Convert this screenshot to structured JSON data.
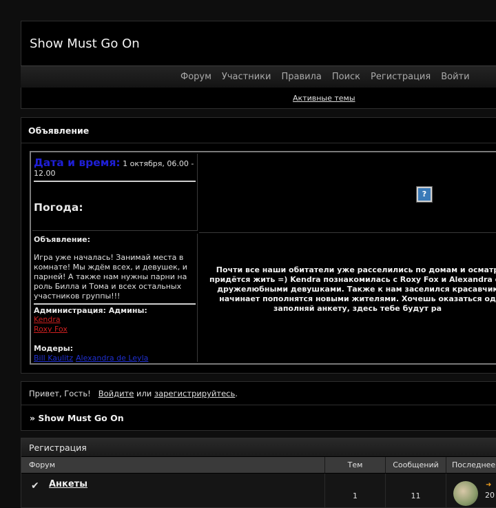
{
  "site": {
    "title": "Show Must Go On"
  },
  "nav": {
    "items": [
      "Форум",
      "Участники",
      "Правила",
      "Поиск",
      "Регистрация",
      "Войти"
    ]
  },
  "active_topics": "Активные темы",
  "announcement": {
    "title": "Объявление",
    "date_label": "Дата и время:",
    "date_value": "1 октября, 06.00 - 12.00",
    "weather_label": "Погода:",
    "image_alt": "?",
    "info_head": "Объявление:",
    "info_body": "Игра уже началась! Занимай места в комнате! Мы ждём всех, и девушек, и парней! А также нам нужны парни на роль Билла и Тома и всех остальных участников группы!!!",
    "admin_head": "Администрация: Админы:",
    "admins": [
      "Kendra",
      "Roxy Fox"
    ],
    "mod_head": "Модеры:",
    "mods": [
      "Bill Kaulitz",
      "Alexandra de Leyla"
    ],
    "big_text": "Почти все наши обитатели уже расселились по домам и осматр придётся жить =) Kendra познакомилась с Roxy Fox и Alexandra de дружелюбными девушками. Также к нам заселился красавчик начинает пополнятся новыми жителями. Хочешь оказаться од заполняй анкету, здесь тебе будут ра"
  },
  "guest": {
    "greeting": "Привет, Гость!",
    "login": "Войдите",
    "or": "или",
    "register": "зарегистрируйтесь",
    "dot": "."
  },
  "breadcrumb": "» Show Must Go On",
  "forum": {
    "category": "Регистрация",
    "headers": {
      "forum": "Форум",
      "topics": "Тем",
      "posts": "Сообщений",
      "last": "Последнее"
    },
    "rows": [
      {
        "name": "Анкеты",
        "topics": "1",
        "posts": "11",
        "last_date": "20"
      }
    ]
  },
  "colors": {
    "date_label": "#1f1fd6",
    "admin_link": "#d02020",
    "mod_link": "#1f2fd0"
  }
}
